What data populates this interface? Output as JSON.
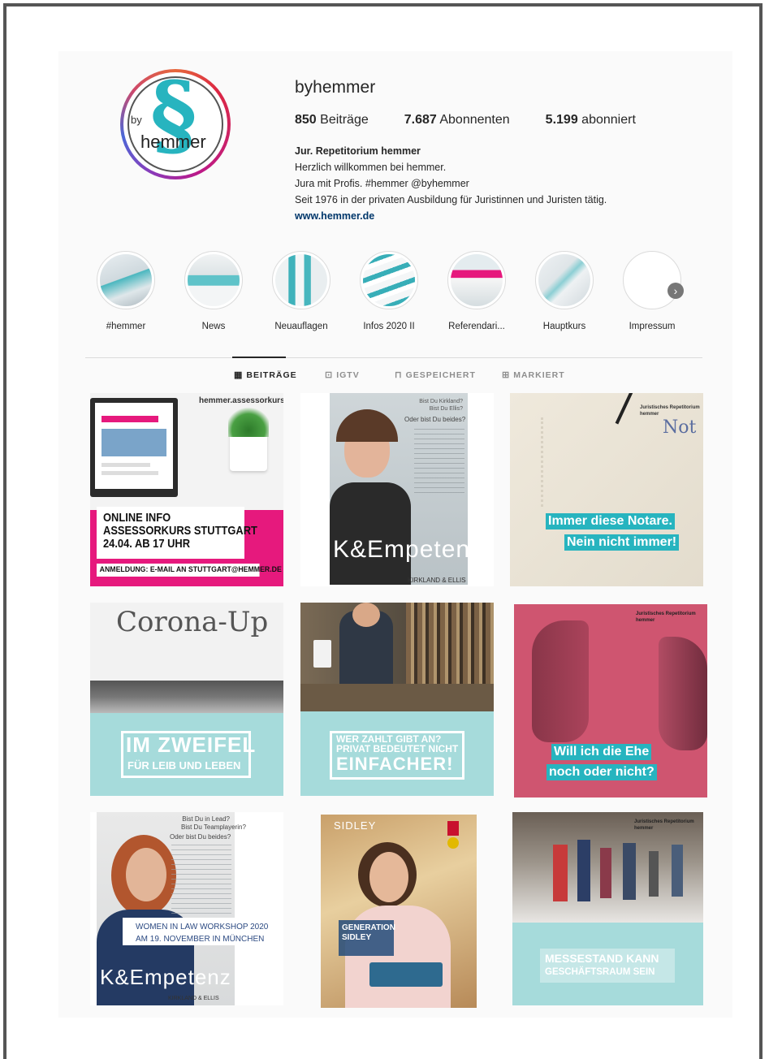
{
  "profile": {
    "username": "byhemmer",
    "avatar_text": {
      "by": "by",
      "word": "hemmer",
      "symbol": "§"
    },
    "stats": [
      {
        "count": "850",
        "label": "Beiträge"
      },
      {
        "count": "7.687",
        "label": "Abonnenten"
      },
      {
        "count": "5.199",
        "label": "abonniert"
      }
    ],
    "bio": {
      "name": "Jur. Repetitorium hemmer",
      "lines": [
        "Herzlich willkommen bei hemmer.",
        "Jura mit Profis. #hemmer @byhemmer",
        "Seit 1976 in der privaten Ausbildung für Juristinnen und Juristen tätig."
      ],
      "website": "www.hemmer.de"
    }
  },
  "highlights": [
    {
      "label": "#hemmer"
    },
    {
      "label": "News"
    },
    {
      "label": "Neuauflagen"
    },
    {
      "label": "Infos 2020 II"
    },
    {
      "label": "Referendari..."
    },
    {
      "label": "Hauptkurs"
    },
    {
      "label": "Impressum"
    }
  ],
  "tabs": [
    {
      "label": "BEITRÄGE",
      "icon": "grid-icon",
      "glyph": "▦"
    },
    {
      "label": "IGTV",
      "icon": "igtv-icon",
      "glyph": "⊡"
    },
    {
      "label": "GESPEICHERT",
      "icon": "bookmark-icon",
      "glyph": "⊓"
    },
    {
      "label": "MARKIERT",
      "icon": "tagged-icon",
      "glyph": "⊞"
    }
  ],
  "posts": {
    "p1": {
      "brand": "hemmer.assessorkurs",
      "l1": "ONLINE INFO",
      "l2": "ASSESSORKURS STUTTGART",
      "l3": "24.04. AB 17 UHR",
      "l4": "ANMELDUNG: E-MAIL AN STUTTGART@HEMMER.DE"
    },
    "p2": {
      "q1": "Bist Du Kirkland?",
      "q2": "Bist Du Ellis?",
      "q3": "Oder bist Du beides?",
      "big": "K&Empetenz",
      "sub": "KIRKLAND & ELLIS"
    },
    "p3": {
      "corner": "Juristisches Repetitorium hemmer",
      "word": "Not",
      "l1": "Immer diese Notare.",
      "l2": "Nein nicht immer!"
    },
    "p4": {
      "top": "Corona-Up",
      "l1": "IM ZWEIFEL",
      "l2": "FÜR LEIB UND LEBEN"
    },
    "p5": {
      "l1": "WER ZAHLT GIBT AN?",
      "l2": "PRIVAT BEDEUTET NICHT",
      "l3": "EINFACHER!"
    },
    "p6": {
      "corner": "Juristisches Repetitorium hemmer",
      "l1": "Will ich die Ehe",
      "l2": "noch oder nicht?"
    },
    "p7": {
      "q1": "Bist Du in Lead?",
      "q2": "Bist Du Teamplayerin?",
      "q3": "Oder bist Du beides?",
      "l1": "WOMEN IN LAW WORKSHOP 2020",
      "l2": "AM 19. NOVEMBER IN MÜNCHEN",
      "big": "K&Empetenz",
      "sub": "KIRKLAND & ELLIS"
    },
    "p8": {
      "brand": "SIDLEY",
      "l1": "GENERATION",
      "l2": "SIDLEY"
    },
    "p9": {
      "corner": "Juristisches Repetitorium hemmer",
      "l1": "MESSESTAND KANN",
      "l2": "GESCHÄFTSRAUM SEIN"
    }
  },
  "colors": {
    "accent": "#27b4bf",
    "teal_bg": "#a6dbdb",
    "pink": "#e6197d",
    "rose": "#cf5570"
  }
}
